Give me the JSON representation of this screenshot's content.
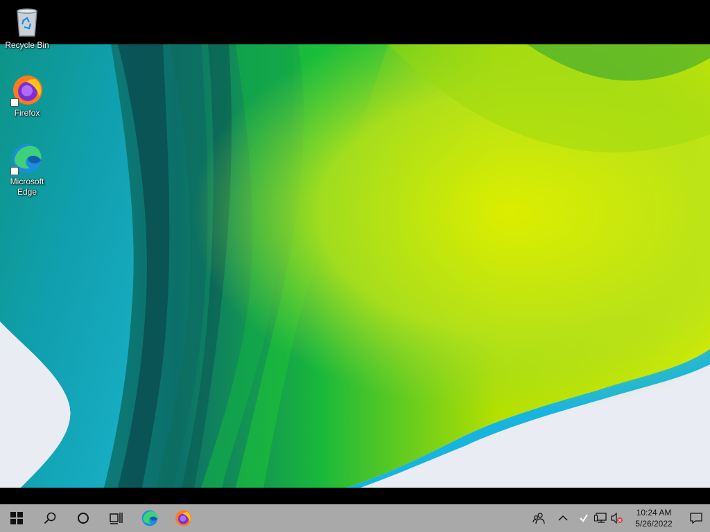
{
  "desktop": {
    "icons": [
      {
        "label": "Recycle Bin",
        "icon": "recycle-bin-icon"
      },
      {
        "label": "Firefox",
        "icon": "firefox-icon"
      },
      {
        "label": "Microsoft Edge",
        "icon": "edge-icon"
      }
    ]
  },
  "taskbar": {
    "buttons": [
      {
        "icon": "windows-start-icon"
      },
      {
        "icon": "search-icon"
      },
      {
        "icon": "cortana-icon"
      },
      {
        "icon": "task-view-icon"
      },
      {
        "icon": "edge-icon"
      },
      {
        "icon": "firefox-icon"
      }
    ],
    "tray": {
      "icons": [
        "people-icon",
        "chevron-up-icon",
        "check-icon",
        "network-icon",
        "volume-muted-icon"
      ],
      "time": "10:24 AM",
      "date": "5/26/2022"
    },
    "notification_icon": "action-center-icon"
  }
}
